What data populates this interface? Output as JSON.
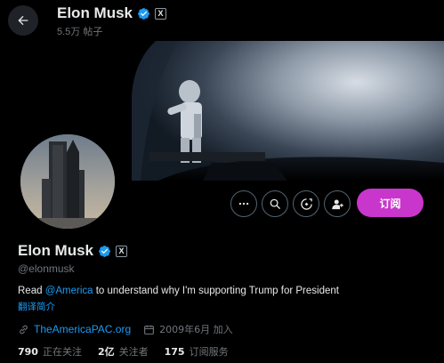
{
  "header": {
    "title": "Elon Musk",
    "post_count": "5.5万 帖子"
  },
  "profile": {
    "name": "Elon Musk",
    "handle": "@elonmusk",
    "bio": {
      "prefix": "Read ",
      "mention": "@America",
      "suffix": " to understand why I'm supporting Trump for President"
    },
    "translate_label": "翻译简介",
    "website": "TheAmericaPAC.org",
    "joined": "2009年6月 加入",
    "badge_x": "X"
  },
  "actions": {
    "subscribe_label": "订阅",
    "more_icon": "more-dots-icon",
    "search_icon": "search-icon",
    "grok_icon": "grok-icon",
    "notify_icon": "person-notify-icon"
  },
  "stats": {
    "following_count": "790",
    "following_label": "正在关注",
    "followers_count": "2亿",
    "followers_label": "关注者",
    "subscriptions_count": "175",
    "subscriptions_label": "订阅服务"
  },
  "colors": {
    "accent_blue": "#1d9bf0",
    "subscribe_bg": "#c936cc",
    "background": "#000000",
    "text_secondary": "#71767b"
  }
}
